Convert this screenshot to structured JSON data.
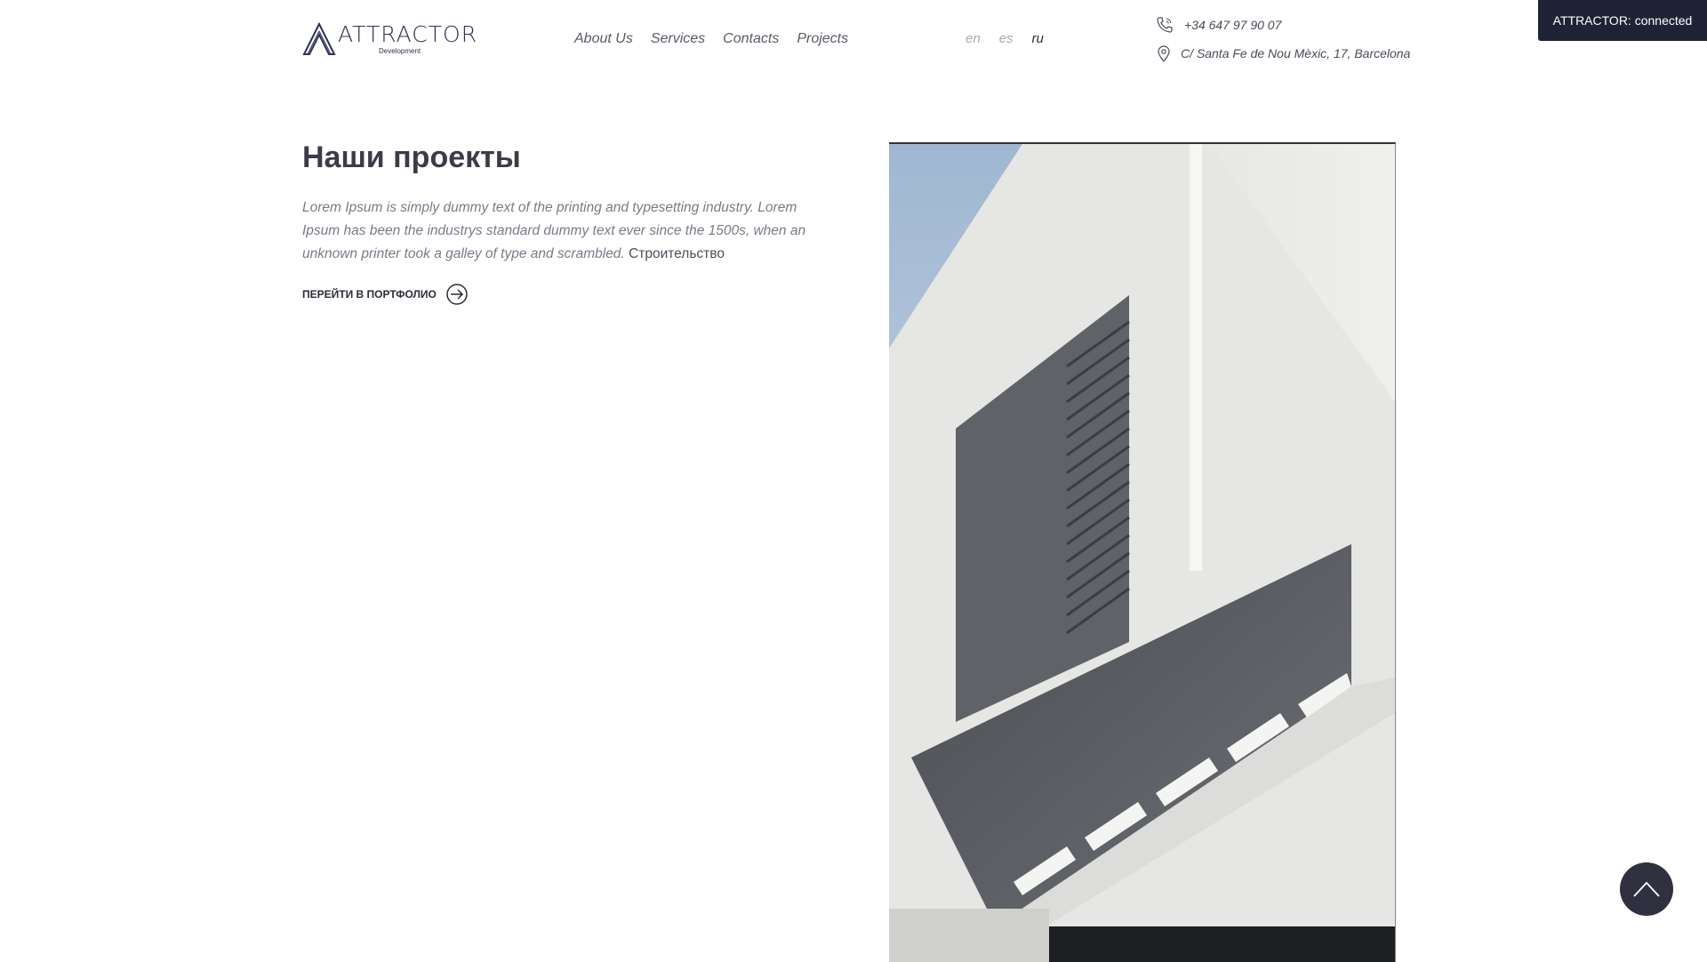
{
  "brand": {
    "name": "ATTRACTOR",
    "tagline": "Development",
    "accent": "#2f3153"
  },
  "nav": {
    "items": [
      {
        "label": "About Us"
      },
      {
        "label": "Services"
      },
      {
        "label": "Contacts"
      },
      {
        "label": "Projects"
      }
    ]
  },
  "languages": {
    "items": [
      {
        "label": "en"
      },
      {
        "label": "es"
      },
      {
        "label": "ru",
        "active": true
      }
    ]
  },
  "contacts": {
    "phone": "+34 647 97 90 07",
    "address": "C/ Santa Fe de Nou Mèxic, 17, Barcelona",
    "phone_icon": "phone-icon",
    "address_icon": "map-pin-icon"
  },
  "status": {
    "text": "ATTRACTOR: connected",
    "background": "#1e2235"
  },
  "hero": {
    "title": "Наши проекты",
    "body": "Lorem Ipsum is simply dummy text of the printing and typesetting industry. Lorem Ipsum has been the industrys standard dummy text ever since the 1500s, when an unknown printer took a galley of type and scrambled.",
    "tag": "Строительство",
    "cta_label": "ПЕРЕЙТИ В ПОРТФОЛИО",
    "cta_icon": "arrow-right-circle-icon"
  },
  "project_image": {
    "icon": "building-photo"
  },
  "scroll_top": {
    "icon": "chevron-up-icon",
    "background": "#303040"
  }
}
